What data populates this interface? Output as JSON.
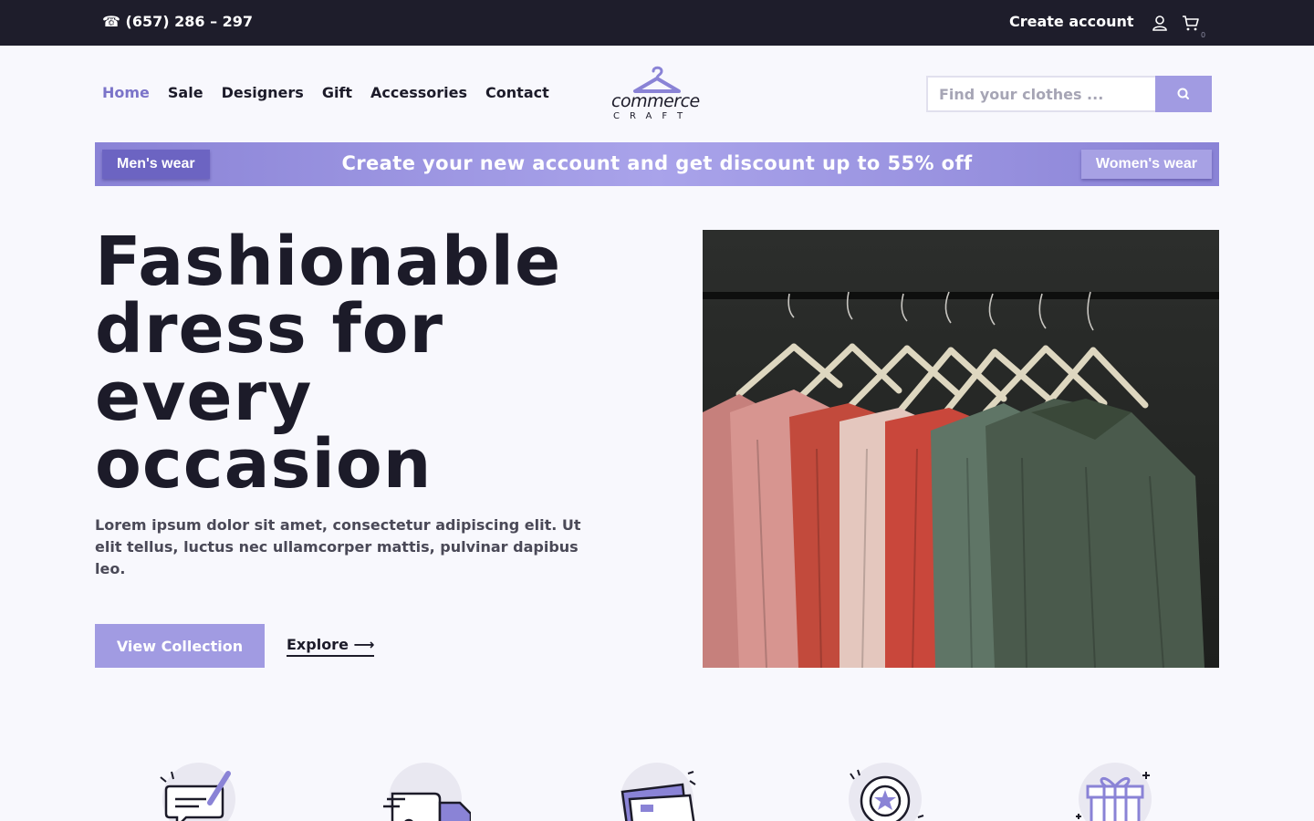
{
  "topbar": {
    "phone": "☎ (657) 286 – 297",
    "create_account": "Create account",
    "cart_count": "0",
    "icons": [
      "user-icon",
      "cart-icon"
    ]
  },
  "nav": {
    "items": [
      {
        "label": "Home",
        "active": true
      },
      {
        "label": "Sale"
      },
      {
        "label": "Designers"
      },
      {
        "label": "Gift"
      },
      {
        "label": "Accessories"
      },
      {
        "label": "Contact"
      }
    ]
  },
  "logo": {
    "word": "commerce",
    "sub": "CRAFT"
  },
  "search": {
    "placeholder": "Find your clothes ...",
    "value": "",
    "icon": "search-icon"
  },
  "promo": {
    "left_label": "Men's wear",
    "message": "Create your new account and get discount up to 55% off",
    "right_label": "Women's wear"
  },
  "hero": {
    "title": "Fashionable dress for every occasion",
    "text": "Lorem ipsum dolor sit amet, consectetur adipiscing elit. Ut elit tellus, luctus nec ullamcorper mattis, pulvinar dapibus leo.",
    "primary_button": "View Collection",
    "secondary_link": "Explore ⟶",
    "image": "clothes-on-hangers"
  },
  "features": {
    "icons": [
      "chat-edit-icon",
      "delivery-truck-icon",
      "credit-card-icon",
      "quality-badge-icon",
      "gift-box-icon"
    ]
  },
  "colors": {
    "accent": "#a19be2",
    "accent_dark": "#6c64c2",
    "topbar_bg": "#1e1d2b",
    "text_dark": "#1c1b29"
  }
}
